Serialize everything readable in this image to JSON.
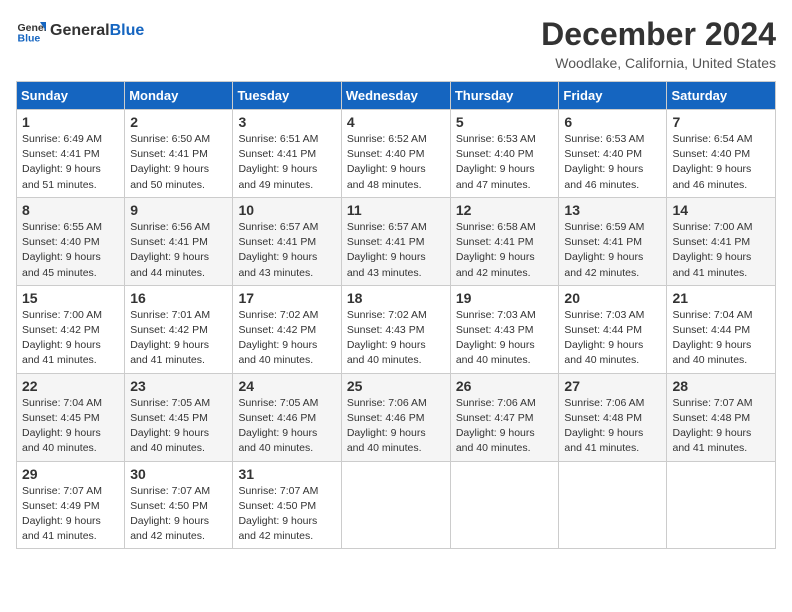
{
  "logo": {
    "general": "General",
    "blue": "Blue"
  },
  "title": "December 2024",
  "subtitle": "Woodlake, California, United States",
  "days_of_week": [
    "Sunday",
    "Monday",
    "Tuesday",
    "Wednesday",
    "Thursday",
    "Friday",
    "Saturday"
  ],
  "weeks": [
    [
      {
        "day": "1",
        "sunrise": "6:49 AM",
        "sunset": "4:41 PM",
        "daylight": "9 hours and 51 minutes."
      },
      {
        "day": "2",
        "sunrise": "6:50 AM",
        "sunset": "4:41 PM",
        "daylight": "9 hours and 50 minutes."
      },
      {
        "day": "3",
        "sunrise": "6:51 AM",
        "sunset": "4:41 PM",
        "daylight": "9 hours and 49 minutes."
      },
      {
        "day": "4",
        "sunrise": "6:52 AM",
        "sunset": "4:40 PM",
        "daylight": "9 hours and 48 minutes."
      },
      {
        "day": "5",
        "sunrise": "6:53 AM",
        "sunset": "4:40 PM",
        "daylight": "9 hours and 47 minutes."
      },
      {
        "day": "6",
        "sunrise": "6:53 AM",
        "sunset": "4:40 PM",
        "daylight": "9 hours and 46 minutes."
      },
      {
        "day": "7",
        "sunrise": "6:54 AM",
        "sunset": "4:40 PM",
        "daylight": "9 hours and 46 minutes."
      }
    ],
    [
      {
        "day": "8",
        "sunrise": "6:55 AM",
        "sunset": "4:40 PM",
        "daylight": "9 hours and 45 minutes."
      },
      {
        "day": "9",
        "sunrise": "6:56 AM",
        "sunset": "4:41 PM",
        "daylight": "9 hours and 44 minutes."
      },
      {
        "day": "10",
        "sunrise": "6:57 AM",
        "sunset": "4:41 PM",
        "daylight": "9 hours and 43 minutes."
      },
      {
        "day": "11",
        "sunrise": "6:57 AM",
        "sunset": "4:41 PM",
        "daylight": "9 hours and 43 minutes."
      },
      {
        "day": "12",
        "sunrise": "6:58 AM",
        "sunset": "4:41 PM",
        "daylight": "9 hours and 42 minutes."
      },
      {
        "day": "13",
        "sunrise": "6:59 AM",
        "sunset": "4:41 PM",
        "daylight": "9 hours and 42 minutes."
      },
      {
        "day": "14",
        "sunrise": "7:00 AM",
        "sunset": "4:41 PM",
        "daylight": "9 hours and 41 minutes."
      }
    ],
    [
      {
        "day": "15",
        "sunrise": "7:00 AM",
        "sunset": "4:42 PM",
        "daylight": "9 hours and 41 minutes."
      },
      {
        "day": "16",
        "sunrise": "7:01 AM",
        "sunset": "4:42 PM",
        "daylight": "9 hours and 41 minutes."
      },
      {
        "day": "17",
        "sunrise": "7:02 AM",
        "sunset": "4:42 PM",
        "daylight": "9 hours and 40 minutes."
      },
      {
        "day": "18",
        "sunrise": "7:02 AM",
        "sunset": "4:43 PM",
        "daylight": "9 hours and 40 minutes."
      },
      {
        "day": "19",
        "sunrise": "7:03 AM",
        "sunset": "4:43 PM",
        "daylight": "9 hours and 40 minutes."
      },
      {
        "day": "20",
        "sunrise": "7:03 AM",
        "sunset": "4:44 PM",
        "daylight": "9 hours and 40 minutes."
      },
      {
        "day": "21",
        "sunrise": "7:04 AM",
        "sunset": "4:44 PM",
        "daylight": "9 hours and 40 minutes."
      }
    ],
    [
      {
        "day": "22",
        "sunrise": "7:04 AM",
        "sunset": "4:45 PM",
        "daylight": "9 hours and 40 minutes."
      },
      {
        "day": "23",
        "sunrise": "7:05 AM",
        "sunset": "4:45 PM",
        "daylight": "9 hours and 40 minutes."
      },
      {
        "day": "24",
        "sunrise": "7:05 AM",
        "sunset": "4:46 PM",
        "daylight": "9 hours and 40 minutes."
      },
      {
        "day": "25",
        "sunrise": "7:06 AM",
        "sunset": "4:46 PM",
        "daylight": "9 hours and 40 minutes."
      },
      {
        "day": "26",
        "sunrise": "7:06 AM",
        "sunset": "4:47 PM",
        "daylight": "9 hours and 40 minutes."
      },
      {
        "day": "27",
        "sunrise": "7:06 AM",
        "sunset": "4:48 PM",
        "daylight": "9 hours and 41 minutes."
      },
      {
        "day": "28",
        "sunrise": "7:07 AM",
        "sunset": "4:48 PM",
        "daylight": "9 hours and 41 minutes."
      }
    ],
    [
      {
        "day": "29",
        "sunrise": "7:07 AM",
        "sunset": "4:49 PM",
        "daylight": "9 hours and 41 minutes."
      },
      {
        "day": "30",
        "sunrise": "7:07 AM",
        "sunset": "4:50 PM",
        "daylight": "9 hours and 42 minutes."
      },
      {
        "day": "31",
        "sunrise": "7:07 AM",
        "sunset": "4:50 PM",
        "daylight": "9 hours and 42 minutes."
      },
      null,
      null,
      null,
      null
    ]
  ]
}
